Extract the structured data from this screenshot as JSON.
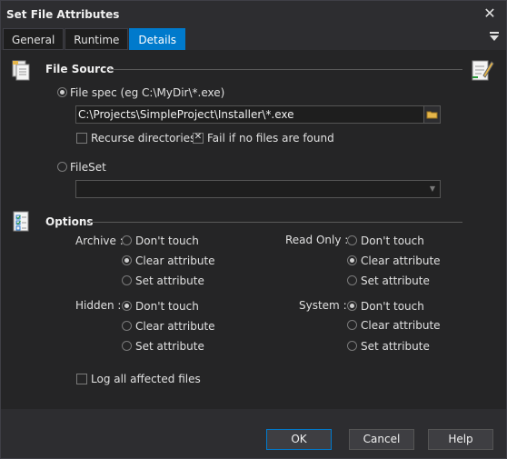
{
  "window": {
    "title": "Set File Attributes"
  },
  "tabs": [
    {
      "label": "General"
    },
    {
      "label": "Runtime"
    },
    {
      "label": "Details"
    }
  ],
  "file_source": {
    "title": "File Source",
    "filespec_label": "File spec (eg C:\\MyDir\\*.exe)",
    "filespec_value": "C:\\Projects\\SimpleProject\\Installer\\*.exe",
    "recurse_label": "Recurse directories",
    "recurse_checked": false,
    "fail_label": "Fail if no files are found",
    "fail_checked": true,
    "fileset_label": "FileSet",
    "fileset_value": ""
  },
  "options": {
    "title": "Options",
    "archive": {
      "label": "Archive :",
      "choices": [
        "Don't touch",
        "Clear attribute",
        "Set attribute"
      ],
      "selected": 1
    },
    "readonly": {
      "label": "Read Only :",
      "choices": [
        "Don't touch",
        "Clear attribute",
        "Set attribute"
      ],
      "selected": 1
    },
    "hidden": {
      "label": "Hidden :",
      "choices": [
        "Don't touch",
        "Clear attribute",
        "Set attribute"
      ],
      "selected": 0
    },
    "system": {
      "label": "System :",
      "choices": [
        "Don't touch",
        "Clear attribute",
        "Set attribute"
      ],
      "selected": 0
    },
    "log_label": "Log all affected files",
    "log_checked": false
  },
  "buttons": {
    "ok": "OK",
    "cancel": "Cancel",
    "help": "Help"
  },
  "colors": {
    "accent": "#007acc",
    "background": "#252526",
    "chrome": "#2d2d30"
  }
}
